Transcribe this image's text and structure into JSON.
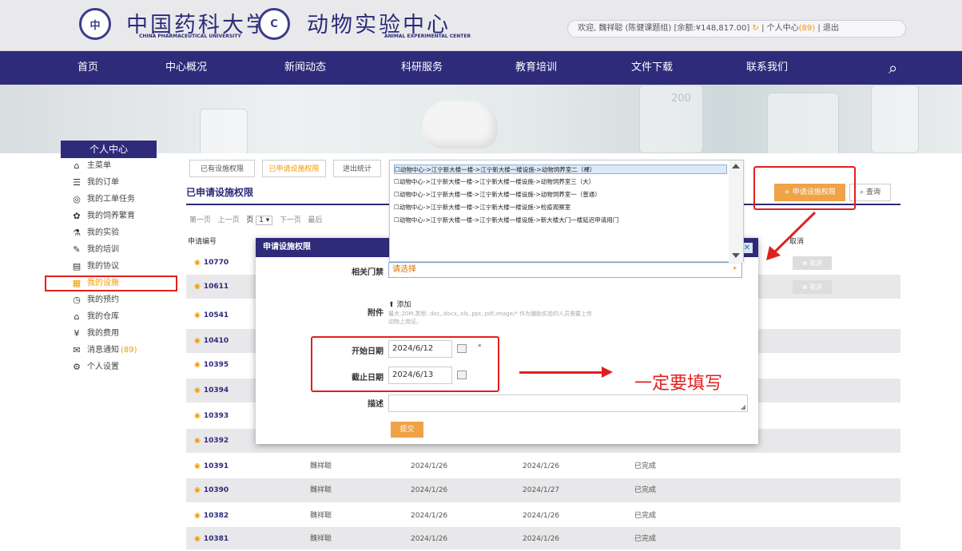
{
  "header": {
    "university_seal": "中",
    "university_name_cn": "中国药科大学",
    "university_name_en": "CHINA PHARMACEUTICAL UNIVERSITY",
    "center_seal": "C",
    "center_name_cn": "动物实验中心",
    "center_name_en": "ANIMAL EXPERIMENTAL CENTER",
    "userbar": {
      "welcome": "欢迎, 魏祥聪 (陈健课题组) [余额:¥148,817.00]",
      "refresh_glyph": "↻",
      "sep1": " | ",
      "personal_center": "个人中心",
      "personal_count": "(89)",
      "sep2": " | ",
      "logout": "退出"
    }
  },
  "nav": {
    "items": [
      "首页",
      "中心概况",
      "新闻动态",
      "科研服务",
      "教育培训",
      "文件下载",
      "联系我们"
    ],
    "search_glyph": "⌕"
  },
  "banner": {
    "number": "200"
  },
  "sidebar": {
    "title": "个人中心",
    "items": [
      {
        "label": "主菜单",
        "icon": "⌂"
      },
      {
        "label": "我的订单",
        "icon": "☰"
      },
      {
        "label": "我的工单任务",
        "icon": "◎"
      },
      {
        "label": "我的饲养繁育",
        "icon": "✿"
      },
      {
        "label": "我的实验",
        "icon": "⚗"
      },
      {
        "label": "我的培训",
        "icon": "✎"
      },
      {
        "label": "我的协议",
        "icon": "▤"
      },
      {
        "label": "我的设施",
        "icon": "▦"
      },
      {
        "label": "我的预约",
        "icon": "◷"
      },
      {
        "label": "我的仓库",
        "icon": "⌂"
      },
      {
        "label": "我的费用",
        "icon": "¥"
      },
      {
        "label": "消息通知",
        "icon": "✉",
        "count": "(89)"
      },
      {
        "label": "个人设置",
        "icon": "⚙"
      }
    ]
  },
  "tabs": [
    "已有设施权限",
    "已申请设施权限",
    "进出统计"
  ],
  "section_title": "已申请设施权限",
  "toolbar": {
    "add_label": "+ 申请设施权限",
    "query_label": "⌕ 查询"
  },
  "pager": {
    "first": "第一页",
    "prev": "上一页",
    "page_label": "页",
    "page_value": "1 ▾",
    "next": "下一页",
    "last": "最后"
  },
  "table": {
    "headers": [
      "申请编号",
      "取消"
    ],
    "rows": [
      {
        "id": "10770",
        "cancel": "⊗ 取消"
      },
      {
        "id": "10611",
        "cancel": "⊗ 取消"
      },
      {
        "id": "10541"
      },
      {
        "id": "10410"
      },
      {
        "id": "10395"
      },
      {
        "id": "10394"
      },
      {
        "id": "10393"
      },
      {
        "id": "10392"
      },
      {
        "id": "10391",
        "applicant": "魏祥聪",
        "start": "2024/1/26",
        "end": "2024/1/26",
        "status": "已完成"
      },
      {
        "id": "10390",
        "applicant": "魏祥聪",
        "start": "2024/1/26",
        "end": "2024/1/27",
        "status": "已完成"
      },
      {
        "id": "10382",
        "applicant": "魏祥聪",
        "start": "2024/1/26",
        "end": "2024/1/26",
        "status": "已完成"
      },
      {
        "id": "10381",
        "applicant": "魏祥聪",
        "start": "2024/1/26",
        "end": "2024/1/26",
        "status": "已完成"
      }
    ]
  },
  "dropdown": {
    "options": [
      "☐动物中心->江宁新大楼一楼->江宁新大楼一楼设施->动物饲养室二（裸）",
      "☐动物中心->江宁新大楼一楼->江宁新大楼一楼设施->动物饲养室三（大）",
      "☐动物中心->江宁新大楼一楼->江宁新大楼一楼设施->动物饲养室一（普通）",
      "☐动物中心->江宁新大楼一楼->江宁新大楼一楼设施->检疫观察室",
      "☐动物中心->江宁新大楼一楼->江宁新大楼一楼设施->新大楼大门一楼延迟申请用门"
    ]
  },
  "modal": {
    "title": "申请设施权限",
    "close_glyph": "✕",
    "door_label": "相关门禁",
    "door_placeholder": "请选择",
    "attach_label": "附件",
    "attach_add": "⬆ 添加",
    "attach_hint": "最大:20M,类型:.doc,.docx,.xls,.ppt,.pdf,image/* 作为辅助实验的人员需要上传动物上岗证。",
    "start_label": "开始日期",
    "start_value": "2024/6/12",
    "end_label": "截止日期",
    "end_value": "2024/6/13",
    "required_mark": "*",
    "desc_label": "描述",
    "submit_label": "提交"
  },
  "annotation": {
    "note": "一定要填写",
    "color": "#e02020"
  },
  "colors": {
    "primary": "#2d2b7a",
    "accent": "#f39800",
    "button": "#f0a246"
  }
}
